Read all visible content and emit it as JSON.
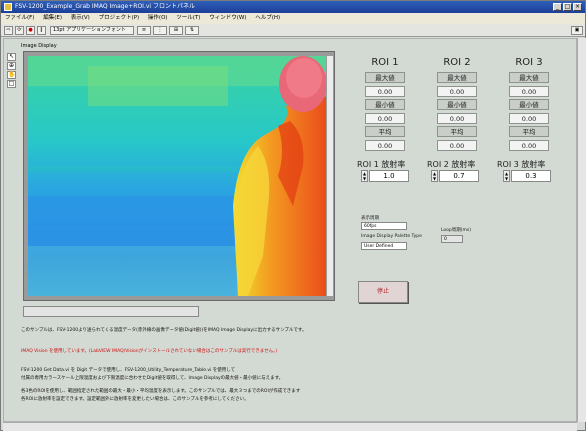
{
  "window": {
    "title": "FSV-1200_Example_Grab IMAQ Image+ROI.vi フロントパネル"
  },
  "menu": [
    "ファイル(F)",
    "編集(E)",
    "表示(V)",
    "プロジェクト(P)",
    "操作(O)",
    "ツール(T)",
    "ウィンドウ(W)",
    "ヘルプ(H)"
  ],
  "toolbar": {
    "font_select": "13pt アプリケーションフォント"
  },
  "display": {
    "label": "Image Display"
  },
  "rois": [
    {
      "title": "ROI 1",
      "max_label": "最大値",
      "max": "0.00",
      "min_label": "最小値",
      "min": "0.00",
      "avg_label": "平均",
      "avg": "0.00",
      "em_label": "ROI 1 放射率",
      "em": "1.0"
    },
    {
      "title": "ROI 2",
      "max_label": "最大値",
      "max": "0.00",
      "min_label": "最小値",
      "min": "0.00",
      "avg_label": "平均",
      "avg": "0.00",
      "em_label": "ROI 2 放射率",
      "em": "0.7"
    },
    {
      "title": "ROI 3",
      "max_label": "最大値",
      "max": "0.00",
      "min_label": "最小値",
      "min": "0.00",
      "avg_label": "平均",
      "avg": "0.00",
      "em_label": "ROI 3 放射率",
      "em": "0.3"
    }
  ],
  "controls": {
    "interval_label": "表示周期",
    "interval_value": "60fps",
    "palette_label": "Image Display Palette Type",
    "palette_value": "User Defined",
    "loop_label": "Loop周期(ms)",
    "loop_value": "0",
    "stop_label": "停止"
  },
  "notes": [
    "このサンプルは、FSV-1200より送られてくる温度データ(赤外線の画像データ値(Digit値))をIMAQ Image Displayに出力するサンプルです。",
    "IMAQ Vision を使用しています。(LabVIEW IMAQ/Visionがインストールされていない場合はこのサンプルは実行できません。)",
    "FSV-1200 Get Data.vi を Digit データで使用し、FSV-1200_Utility_Temperature_Table.vi を使用して",
    "付属の専用カラースケール上限温度および下限温度に合わせたDigit値を取得して、Image Displayの最大値・最小値に与えます。",
    "各3色のROIを使用し、範囲指定された範囲の最大・最小・平均温度を表示します。このサンプルでは、最大３つまでのROIが作成できます",
    "各ROIに放射率を設定できます。設定範囲外に放射率を変更したい場合は、このサンプルを参考にしてください。"
  ]
}
